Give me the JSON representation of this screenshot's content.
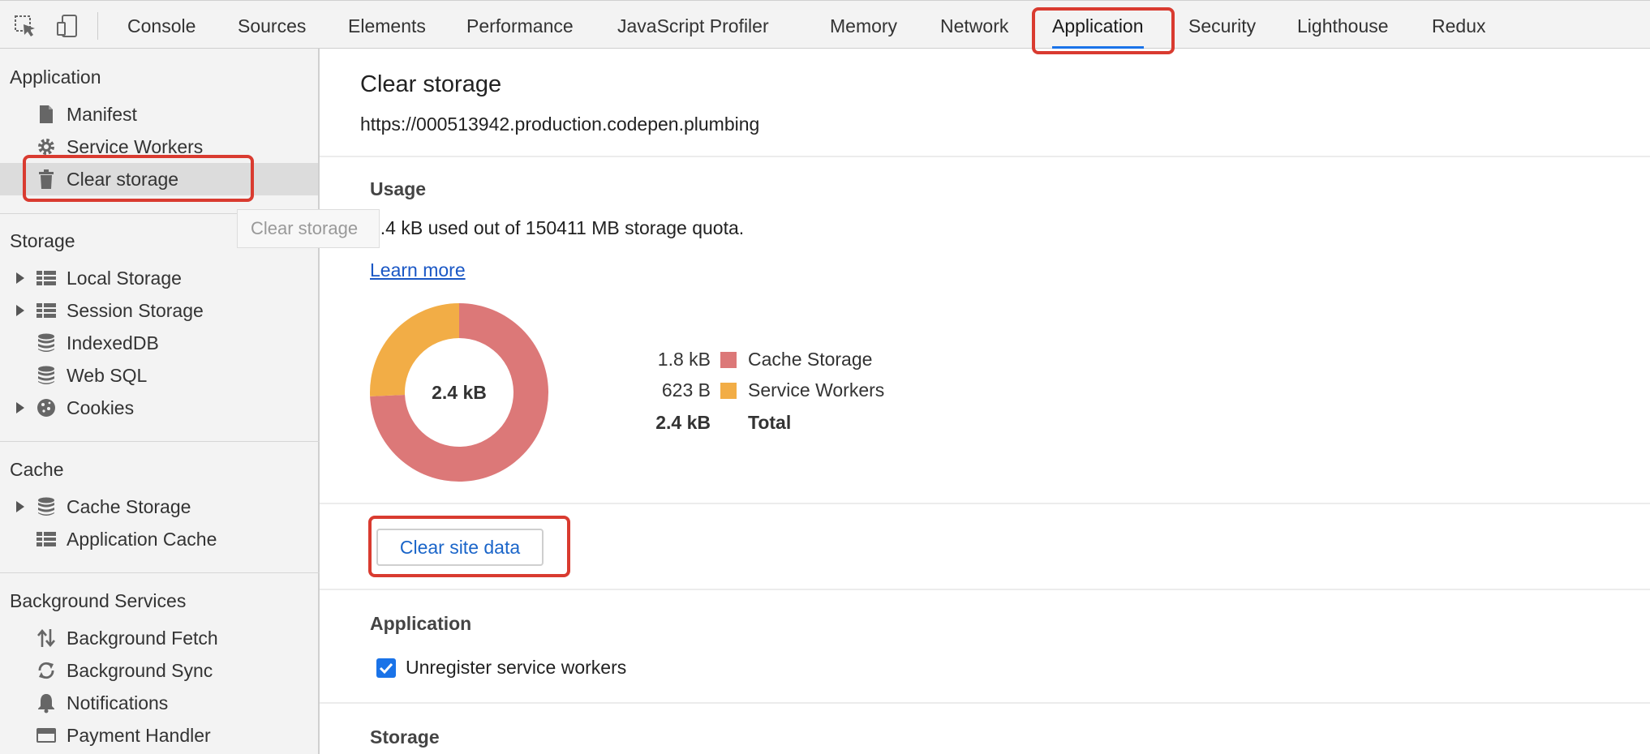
{
  "toolbar": {
    "tabs": [
      {
        "label": "Console"
      },
      {
        "label": "Sources"
      },
      {
        "label": "Elements"
      },
      {
        "label": "Performance"
      },
      {
        "label": "JavaScript Profiler"
      },
      {
        "label": "Memory"
      },
      {
        "label": "Network"
      },
      {
        "label": "Application",
        "active": true
      },
      {
        "label": "Security"
      },
      {
        "label": "Lighthouse"
      },
      {
        "label": "Redux"
      }
    ]
  },
  "sidebar": {
    "sections": [
      {
        "title": "Application",
        "items": [
          {
            "label": "Manifest",
            "icon": "document-icon"
          },
          {
            "label": "Service Workers",
            "icon": "gear-icon"
          },
          {
            "label": "Clear storage",
            "icon": "trash-icon",
            "selected": true
          }
        ]
      },
      {
        "title": "Storage",
        "items": [
          {
            "label": "Local Storage",
            "icon": "grid-icon",
            "expandable": true
          },
          {
            "label": "Session Storage",
            "icon": "grid-icon",
            "expandable": true
          },
          {
            "label": "IndexedDB",
            "icon": "database-icon"
          },
          {
            "label": "Web SQL",
            "icon": "database-icon"
          },
          {
            "label": "Cookies",
            "icon": "cookie-icon",
            "expandable": true
          }
        ]
      },
      {
        "title": "Cache",
        "items": [
          {
            "label": "Cache Storage",
            "icon": "database-icon",
            "expandable": true
          },
          {
            "label": "Application Cache",
            "icon": "grid-icon"
          }
        ]
      },
      {
        "title": "Background Services",
        "items": [
          {
            "label": "Background Fetch",
            "icon": "arrows-updown-icon"
          },
          {
            "label": "Background Sync",
            "icon": "sync-icon"
          },
          {
            "label": "Notifications",
            "icon": "bell-icon"
          },
          {
            "label": "Payment Handler",
            "icon": "card-icon"
          }
        ]
      }
    ]
  },
  "tooltip": {
    "text": "Clear storage"
  },
  "main": {
    "title": "Clear storage",
    "origin": "https://000513942.production.codepen.plumbing",
    "usage": {
      "heading": "Usage",
      "text": "2.4 kB used out of 150411 MB storage quota.",
      "learn_more": "Learn more",
      "center_label": "2.4 kB",
      "legend": [
        {
          "value": "1.8 kB",
          "name": "Cache Storage",
          "color": "#dc7878"
        },
        {
          "value": "623 B",
          "name": "Service Workers",
          "color": "#f2ad46"
        }
      ],
      "total": {
        "value": "2.4 kB",
        "name": "Total"
      }
    },
    "clear_button": "Clear site data",
    "application": {
      "heading": "Application",
      "checkbox_label": "Unregister service workers",
      "checked": true
    },
    "storage": {
      "heading": "Storage"
    }
  },
  "chart_data": {
    "type": "pie",
    "categories": [
      "Cache Storage",
      "Service Workers"
    ],
    "values": [
      1800,
      623
    ],
    "unit": "B",
    "center_label": "2.4 kB",
    "colors": [
      "#dc7878",
      "#f2ad46"
    ]
  },
  "colors": {
    "highlight": "#d93b30",
    "accent": "#1a73e8",
    "link": "#1a57c5"
  }
}
